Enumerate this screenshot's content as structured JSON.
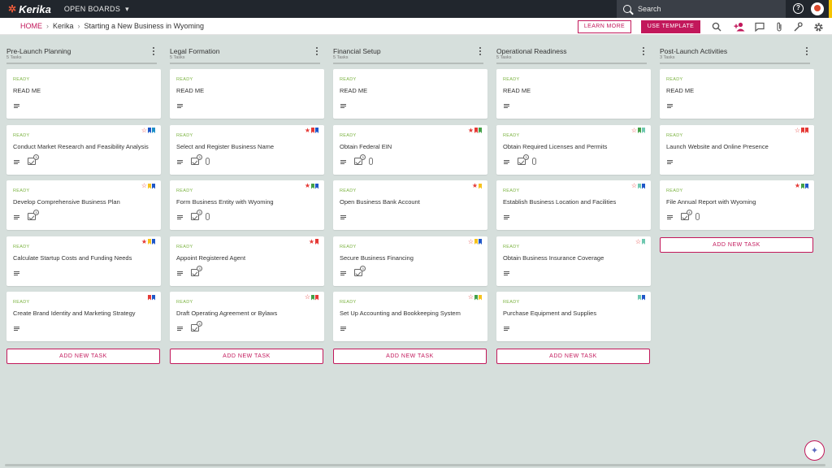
{
  "topbar": {
    "logo": "Kerika",
    "logo_icon": "kerika-logo-icon",
    "boards_menu": "OPEN BOARDS",
    "search_label": "Search",
    "search_placeholder": "Search",
    "help_icon": "?"
  },
  "breadcrumb": {
    "home": "HOME",
    "org": "Kerika",
    "board": "Starting a New Business in Wyoming"
  },
  "toolbar": {
    "learn_more": "LEARN MORE",
    "use_template": "USE TEMPLATE",
    "icons": [
      "search-icon",
      "add-person-icon",
      "chat-icon",
      "attachment-icon",
      "tools-icon",
      "settings-icon"
    ]
  },
  "colors": {
    "accent": "#c2185b",
    "ready": "#7cb342",
    "flag_red": "#e53935",
    "flag_blue": "#1e56c8",
    "flag_yellow": "#f6c21c",
    "flag_green": "#43a047",
    "flag_teal": "#6fc8b0"
  },
  "add_task_label": "ADD NEW TASK",
  "columns": [
    {
      "title": "Pre-Launch Planning",
      "count": "5 Tasks",
      "cards": [
        {
          "status": "READY",
          "title": "READ ME",
          "checklist": null,
          "attachment": false,
          "star": null,
          "flags": []
        },
        {
          "status": "READY",
          "title": "Conduct Market Research and Feasibility Analysis",
          "checklist": "3",
          "attachment": false,
          "star": "empty",
          "flags": [
            "#1e56c8",
            "#1e90c8"
          ]
        },
        {
          "status": "READY",
          "title": "Develop Comprehensive Business Plan",
          "checklist": "3",
          "attachment": false,
          "star": "empty",
          "flags": [
            "#f6c21c",
            "#1e56c8"
          ]
        },
        {
          "status": "READY",
          "title": "Calculate Startup Costs and Funding Needs",
          "checklist": null,
          "attachment": false,
          "star": "full",
          "flags": [
            "#f6c21c",
            "#1e56c8"
          ]
        },
        {
          "status": "READY",
          "title": "Create Brand Identity and Marketing Strategy",
          "checklist": null,
          "attachment": false,
          "star": null,
          "flags": [
            "#e53935",
            "#1e56c8"
          ]
        }
      ]
    },
    {
      "title": "Legal Formation",
      "count": "5 Tasks",
      "cards": [
        {
          "status": "READY",
          "title": "READ ME",
          "checklist": null,
          "attachment": false,
          "star": null,
          "flags": []
        },
        {
          "status": "READY",
          "title": "Select and Register Business Name",
          "checklist": "3",
          "attachment": true,
          "star": "full",
          "flags": [
            "#e53935",
            "#1e56c8"
          ]
        },
        {
          "status": "READY",
          "title": "Form Business Entity with Wyoming",
          "checklist": "3",
          "attachment": true,
          "star": "full",
          "flags": [
            "#43a047",
            "#1e56c8"
          ]
        },
        {
          "status": "READY",
          "title": "Appoint Registered Agent",
          "checklist": "3",
          "attachment": false,
          "star": "full",
          "flags": [
            "#e53935"
          ]
        },
        {
          "status": "READY",
          "title": "Draft Operating Agreement or Bylaws",
          "checklist": "3",
          "attachment": false,
          "star": "empty",
          "flags": [
            "#43a047",
            "#e53935"
          ]
        }
      ]
    },
    {
      "title": "Financial Setup",
      "count": "5 Tasks",
      "cards": [
        {
          "status": "READY",
          "title": "READ ME",
          "checklist": null,
          "attachment": false,
          "star": null,
          "flags": []
        },
        {
          "status": "READY",
          "title": "Obtain Federal EIN",
          "checklist": "3",
          "attachment": true,
          "star": "full",
          "flags": [
            "#e53935",
            "#43a047"
          ]
        },
        {
          "status": "READY",
          "title": "Open Business Bank Account",
          "checklist": null,
          "attachment": false,
          "star": "full",
          "flags": [
            "#f6c21c"
          ]
        },
        {
          "status": "READY",
          "title": "Secure Business Financing",
          "checklist": "3",
          "attachment": false,
          "star": "empty",
          "flags": [
            "#f6c21c",
            "#1e56c8"
          ]
        },
        {
          "status": "READY",
          "title": "Set Up Accounting and Bookkeeping System",
          "checklist": null,
          "attachment": false,
          "star": "empty",
          "flags": [
            "#43a047",
            "#f6c21c"
          ]
        }
      ]
    },
    {
      "title": "Operational Readiness",
      "count": "5 Tasks",
      "cards": [
        {
          "status": "READY",
          "title": "READ ME",
          "checklist": null,
          "attachment": false,
          "star": null,
          "flags": []
        },
        {
          "status": "READY",
          "title": "Obtain Required Licenses and Permits",
          "checklist": "3",
          "attachment": true,
          "star": "empty",
          "flags": [
            "#43a047",
            "#6fc8b0"
          ]
        },
        {
          "status": "READY",
          "title": "Establish Business Location and Facilities",
          "checklist": null,
          "attachment": false,
          "star": "empty",
          "flags": [
            "#6fc8b0",
            "#1e56c8"
          ]
        },
        {
          "status": "READY",
          "title": "Obtain Business Insurance Coverage",
          "checklist": null,
          "attachment": false,
          "star": "empty",
          "flags": [
            "#6fc8b0"
          ]
        },
        {
          "status": "READY",
          "title": "Purchase Equipment and Supplies",
          "checklist": null,
          "attachment": false,
          "star": null,
          "flags": [
            "#6fc8b0",
            "#1e56c8"
          ]
        }
      ]
    },
    {
      "title": "Post-Launch Activities",
      "count": "3 Tasks",
      "cards": [
        {
          "status": "READY",
          "title": "READ ME",
          "checklist": null,
          "attachment": false,
          "star": null,
          "flags": []
        },
        {
          "status": "READY",
          "title": "Launch Website and Online Presence",
          "checklist": null,
          "attachment": false,
          "star": "empty",
          "flags": [
            "#e53935",
            "#e53935"
          ]
        },
        {
          "status": "READY",
          "title": "File Annual Report with Wyoming",
          "checklist": "4",
          "attachment": true,
          "star": "full",
          "flags": [
            "#43a047",
            "#1e56c8"
          ]
        }
      ]
    }
  ]
}
